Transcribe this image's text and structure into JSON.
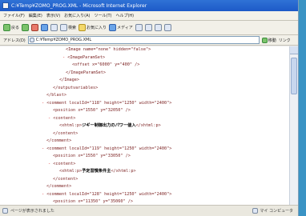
{
  "window": {
    "title": "C:¥Temp¥ZOMO_PROG.XML - Microsoft Internet Explorer"
  },
  "menu": {
    "items": [
      "ファイル(F)",
      "編集(E)",
      "表示(V)",
      "お気に入り(A)",
      "ツール(T)",
      "ヘルプ(H)"
    ]
  },
  "toolbar": {
    "back_label": "戻る",
    "search_label": "検索",
    "favorites_label": "お気に入り",
    "media_label": "メディア"
  },
  "address": {
    "label": "アドレス(D)",
    "value": "C:¥Temp¥ZOMO_PROG.XML",
    "go_label": "移動",
    "links_label": "リンク"
  },
  "xml": {
    "lines": [
      {
        "marker": "",
        "pre": "",
        "tag": "<Image name=\"none\" hidden=\"false\">",
        "text": "",
        "post": ""
      },
      {
        "marker": "-",
        "pre": "",
        "tag": "<ImageParamSet>",
        "text": "",
        "post": ""
      },
      {
        "marker": "",
        "pre": "",
        "tag": "<offset x=\"6000\" y=\"400\" />",
        "text": "",
        "post": ""
      },
      {
        "marker": "",
        "pre": "",
        "tag": "</ImageParamSet>",
        "text": "",
        "post": ""
      },
      {
        "marker": "",
        "pre": "",
        "tag": "</Image>",
        "text": "",
        "post": ""
      },
      {
        "marker": "",
        "pre": "",
        "tag": "</outputvariables>",
        "text": "",
        "post": ""
      },
      {
        "marker": "",
        "pre": "",
        "tag": "</blast>",
        "text": "",
        "post": ""
      },
      {
        "marker": "-",
        "pre": "",
        "tag": "<comment localId=\"118\" height=\"1250\" width=\"2400\">",
        "text": "",
        "post": ""
      },
      {
        "marker": "",
        "pre": "",
        "tag": "<position x=\"1550\" y=\"32050\" />",
        "text": "",
        "post": ""
      },
      {
        "marker": "-",
        "pre": "",
        "tag": "<content>",
        "text": "",
        "post": ""
      },
      {
        "marker": "",
        "pre": "<xhtml:p>",
        "tag": "",
        "text": "ジギー制御出力のパワー値入",
        "post": "</xhtml:p>"
      },
      {
        "marker": "",
        "pre": "",
        "tag": "</content>",
        "text": "",
        "post": ""
      },
      {
        "marker": "",
        "pre": "",
        "tag": "</comment>",
        "text": "",
        "post": ""
      },
      {
        "marker": "-",
        "pre": "",
        "tag": "<comment localId=\"119\" height=\"1250\" width=\"2400\">",
        "text": "",
        "post": ""
      },
      {
        "marker": "",
        "pre": "",
        "tag": "<position x=\"1550\" y=\"33050\" />",
        "text": "",
        "post": ""
      },
      {
        "marker": "-",
        "pre": "",
        "tag": "<content>",
        "text": "",
        "post": ""
      },
      {
        "marker": "",
        "pre": "<xhtml:p>",
        "tag": "",
        "text": "予定習慣条件主",
        "post": "</xhtml:p>"
      },
      {
        "marker": "",
        "pre": "",
        "tag": "</content>",
        "text": "",
        "post": ""
      },
      {
        "marker": "",
        "pre": "",
        "tag": "</comment>",
        "text": "",
        "post": ""
      },
      {
        "marker": "-",
        "pre": "",
        "tag": "<comment localId=\"128\" height=\"1250\" width=\"2400\">",
        "text": "",
        "post": ""
      },
      {
        "marker": "",
        "pre": "",
        "tag": "<position x=\"11350\" y=\"35060\" />",
        "text": "",
        "post": ""
      }
    ]
  },
  "status": {
    "left_text": "ページが表示されました",
    "zone_text": "マイ コンピュータ"
  }
}
